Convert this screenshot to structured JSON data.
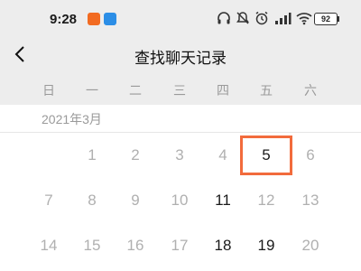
{
  "status_bar": {
    "time": "9:28",
    "battery": "92",
    "icons": [
      "headphones-icon",
      "mute-icon",
      "alarm-icon",
      "signal-icon",
      "wifi-icon"
    ]
  },
  "header": {
    "title": "查找聊天记录"
  },
  "calendar": {
    "weekdays": [
      "日",
      "一",
      "二",
      "三",
      "四",
      "五",
      "六"
    ],
    "month_label": "2021年3月",
    "selected_day": "5",
    "row1": [
      "1",
      "2",
      "3",
      "4",
      "5",
      "6"
    ],
    "row2": [
      "7",
      "8",
      "9",
      "10",
      "11",
      "12",
      "13"
    ],
    "row3": [
      "14",
      "15",
      "16",
      "17",
      "18",
      "19",
      "20"
    ]
  },
  "colors": {
    "accent": "#f26b3c",
    "header_bg": "#ededed",
    "muted_text": "#b0b0b0",
    "active_text": "#1a1a1a"
  }
}
